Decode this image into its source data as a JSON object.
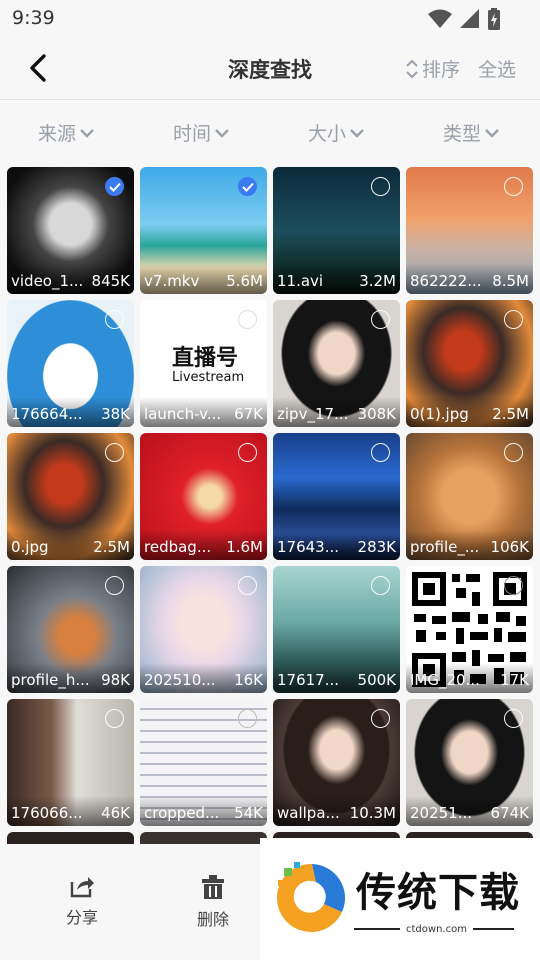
{
  "status": {
    "time": "9:39"
  },
  "header": {
    "title": "深度查找",
    "sort_label": "排序",
    "select_all_label": "全选"
  },
  "filters": [
    {
      "label": "来源"
    },
    {
      "label": "时间"
    },
    {
      "label": "大小"
    },
    {
      "label": "类型"
    }
  ],
  "files": [
    {
      "name": "video_1...",
      "size": "845K",
      "selected": true
    },
    {
      "name": "v7.mkv",
      "size": "5.6M",
      "selected": true
    },
    {
      "name": "11.avi",
      "size": "3.2M",
      "selected": false
    },
    {
      "name": "862222...",
      "size": "8.5M",
      "selected": false
    },
    {
      "name": "176664...",
      "size": "38K",
      "selected": false
    },
    {
      "name": "launch-v...",
      "size": "67K",
      "selected": false
    },
    {
      "name": "zipv_17...",
      "size": "308K",
      "selected": false
    },
    {
      "name": "0(1).jpg",
      "size": "2.5M",
      "selected": false
    },
    {
      "name": "0.jpg",
      "size": "2.5M",
      "selected": false
    },
    {
      "name": "redbag...",
      "size": "1.6M",
      "selected": false
    },
    {
      "name": "17643...",
      "size": "283K",
      "selected": false
    },
    {
      "name": "profile_...",
      "size": "106K",
      "selected": false
    },
    {
      "name": "profile_h...",
      "size": "98K",
      "selected": false
    },
    {
      "name": "202510...",
      "size": "16K",
      "selected": false
    },
    {
      "name": "17617...",
      "size": "500K",
      "selected": false
    },
    {
      "name": "IMG_20...",
      "size": "17K",
      "selected": false
    },
    {
      "name": "176066...",
      "size": "46K",
      "selected": false
    },
    {
      "name": "cropped...",
      "size": "54K",
      "selected": false
    },
    {
      "name": "wallpa...",
      "size": "10.3M",
      "selected": false
    },
    {
      "name": "20251...",
      "size": "674K",
      "selected": false
    }
  ],
  "launch_thumb": {
    "brand": "直播号",
    "sub": "Livestream"
  },
  "bottom_bar": {
    "share_label": "分享",
    "delete_label": "删除"
  },
  "watermark": {
    "text": "传统下载",
    "url": "ctdown.com"
  },
  "colors": {
    "accent": "#3a7cf0",
    "muted": "#9aa0aa"
  }
}
